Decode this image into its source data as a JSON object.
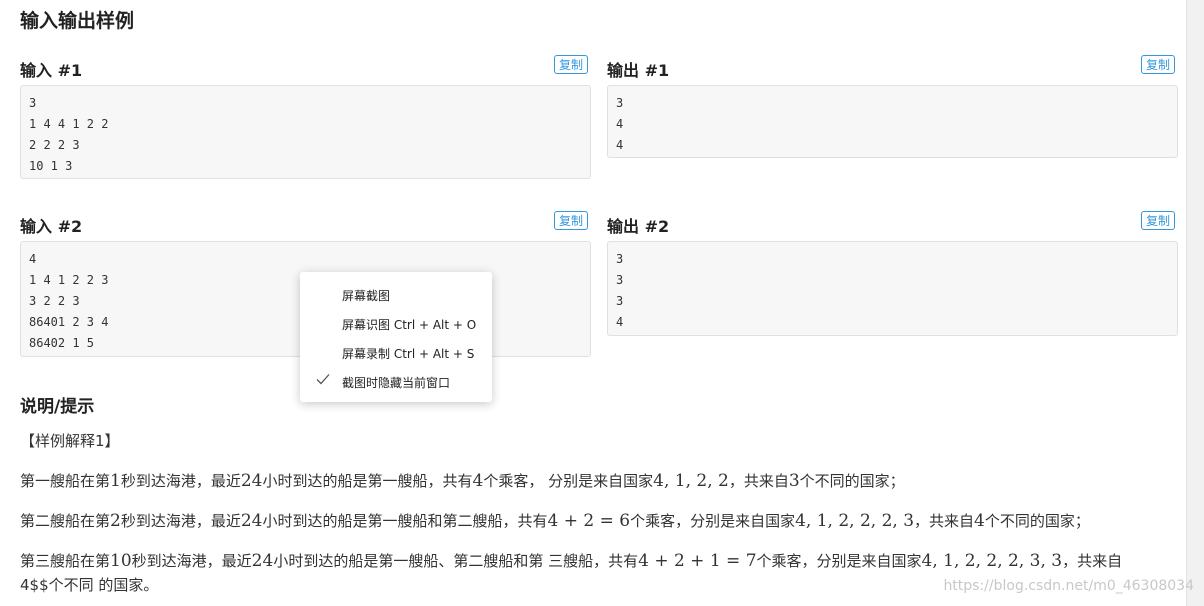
{
  "heading": "输入输出样例",
  "samples": [
    {
      "input_title": "输入 #1",
      "output_title": "输出 #1",
      "input_lines": [
        "3",
        "1 4 4 1 2 2",
        "2 2 2 3",
        "10 1 3"
      ],
      "output_lines": [
        "3",
        "4",
        "4"
      ]
    },
    {
      "input_title": "输入 #2",
      "output_title": "输出 #2",
      "input_lines": [
        "4",
        "1 4 1 2 2 3",
        "3 2 2 3",
        "86401 2 3 4",
        "86402 1 5"
      ],
      "output_lines": [
        "3",
        "3",
        "3",
        "4"
      ]
    }
  ],
  "copy_label": "复制",
  "hint": {
    "title": "说明/提示",
    "sample_label": "【样例解释1】",
    "p1": {
      "a": "第一艘船在第",
      "m1": "1",
      "b": "秒到达海港，最近",
      "m2": "24",
      "c": "小时到达的船是第一艘船，共有",
      "m3": "4",
      "d": "个乘客， 分别是来自国家",
      "m4": "4, 1, 2, 2",
      "e": "，共来自",
      "m5": "3",
      "f": "个不同的国家；"
    },
    "p2": {
      "a": "第二艘船在第",
      "m1": "2",
      "b": "秒到达海港，最近",
      "m2": "24",
      "c": "小时到达的船是第一艘船和第二艘船，共有",
      "m3": "4 + 2 = 6",
      "d": "个乘客，分别是来自国家",
      "m4": "4, 1, 2, 2, 2, 3",
      "e": "，共来自",
      "m5": "4",
      "f": "个不同的国家；"
    },
    "p3": {
      "a": "第三艘船在第",
      "m1": "10",
      "b": "秒到达海港，最近",
      "m2": "24",
      "c": "小时到达的船是第一艘船、第二艘船和第 三艘船，共有",
      "m3": "4 + 2 + 1 = 7",
      "d": "个乘客，分别是来自国家",
      "m4": "4, 1, 2, 2, 2, 3, 3",
      "e": "，共来自",
      "line2": "4$$个不同 的国家。"
    }
  },
  "context_menu": {
    "items": [
      {
        "label": "屏幕截图",
        "checked": false
      },
      {
        "label": "屏幕识图 Ctrl + Alt + O",
        "checked": false
      },
      {
        "label": "屏幕录制 Ctrl + Alt + S",
        "checked": false
      },
      {
        "label": "截图时隐藏当前窗口",
        "checked": true
      }
    ]
  },
  "watermark": "https://blog.csdn.net/m0_46308034"
}
